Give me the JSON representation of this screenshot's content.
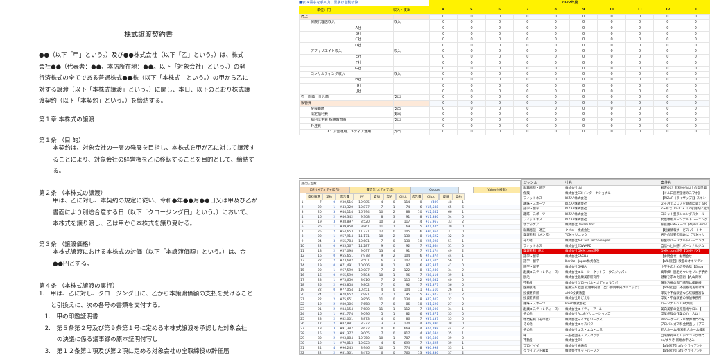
{
  "document": {
    "title": "株式譲渡契約書",
    "intro": [
      "●●（以下「甲」という。）及び●●株式会社（以下「乙」という。）は、株式",
      "会社●●（代表者：●●、本店所在地：●●。以下「対象会社」という。）の発",
      "行済株式の全てである普通株式●●株（以下「本株式」という。）の甲から乙に",
      "対する譲渡（以下「本株式譲渡」という。）に関し、本日、以下のとおり株式譲",
      "渡契約（以下「本契約」という。）を締結する。"
    ],
    "chapter1": "第１章 本株式の譲渡",
    "art1_title": "第１条 （目 的）",
    "art1": [
      "本契約は、対象会社の一層の発展を目指し、本株式を甲が乙に対して譲渡す",
      "ることにより、対象会社の経営権を乙に移転することを目的として、締結す",
      "る。"
    ],
    "art2_title": "第２条 （本株式の譲渡）",
    "art2": [
      "甲は、乙に対し、本契約の規定に従い、令和●年●●月●●日又は甲及び乙が",
      "書面により別途合意する日（以下「クロージング日」という。）において、",
      "本株式を譲り渡し、乙は甲から本株式を譲り受ける。"
    ],
    "art3_title": "第３条 （譲渡価格）",
    "art3": [
      "本株式譲渡における本株式の対価（以下「本譲渡価額」という。）は、金",
      "●●円とする。"
    ],
    "art4_title": "第４条 （本株式譲渡の実行）",
    "art4": [
      "1.　甲は、乙に対し、クロージング日に、乙から本譲渡価額の支払を受けること",
      "　　と引換えに、次の各号の書類を交付する。",
      "　1.　甲の印鑑証明書",
      "　2.　第５条第２号及び第９条第１号に定める本株式譲渡を承認した対象会社",
      "　　　の決議に係る議事録の原本証明付写し",
      "　3.　第１２条第１項及び第２項に定める対象会社の全取締役の辞任届"
    ]
  },
  "sheet": {
    "note": "■表 ※青字を手入力、黒字は自動計算",
    "unit_label": "単位：円",
    "col_kind": "収入・支出",
    "year_label": "2022年度",
    "months": [
      "4",
      "5",
      "6",
      "7",
      "8",
      "9",
      "10",
      "11",
      "12",
      "1"
    ],
    "rows": [
      {
        "label": "売上",
        "kind": "",
        "cls": "sec"
      },
      {
        "label": "保険代理店収入",
        "kind": "収入",
        "cls": "l1"
      },
      {
        "label": "A社",
        "kind": "",
        "cls": "l2"
      },
      {
        "label": "B社",
        "kind": "",
        "cls": "l2"
      },
      {
        "label": "C社",
        "kind": "",
        "cls": "l2"
      },
      {
        "label": "D社",
        "kind": "",
        "cls": "l2"
      },
      {
        "label": "アフィリエイト収入",
        "kind": "収入",
        "cls": "l1"
      },
      {
        "label": "E社",
        "kind": "",
        "cls": "l2"
      },
      {
        "label": "F社",
        "kind": "",
        "cls": "l2"
      },
      {
        "label": "G社",
        "kind": "",
        "cls": "l2"
      },
      {
        "label": "コンサルティング収入",
        "kind": "収入",
        "cls": "l1"
      },
      {
        "label": "H社",
        "kind": "",
        "cls": "l2"
      },
      {
        "label": "I社",
        "kind": "",
        "cls": "l2"
      },
      {
        "label": "J社",
        "kind": "",
        "cls": "l2"
      },
      {
        "label": "売上原価　仕入高",
        "kind": "支出",
        "cls": "l0"
      },
      {
        "label": "販管費",
        "kind": "",
        "cls": "sec"
      },
      {
        "label": "役員報酬",
        "kind": "支出",
        "cls": "l1"
      },
      {
        "label": "法定福利費",
        "kind": "支出",
        "cls": "l1"
      },
      {
        "label": "福利厚生費 採用教育費",
        "kind": "支出",
        "cls": "l1"
      },
      {
        "label": "外注費",
        "kind": "",
        "cls": "l1"
      },
      {
        "label": "X：広告運用、メディア運用",
        "kind": "支出",
        "cls": "l2"
      }
    ],
    "zero": "0"
  },
  "adsheet": {
    "title": "月次広告費",
    "groups": [
      "自社(メディア+広告)",
      "費広告(メディア枠)",
      "Google",
      "Yahoo!(検索)"
    ],
    "cols": [
      "資料請求",
      "契約",
      "広告費",
      "PV",
      "資請",
      "契約",
      "Click",
      "広告費",
      "Click",
      "資請",
      "契約"
    ],
    "rows": [
      [
        "1",
        "7",
        "0",
        "¥30,516",
        "10,985",
        "4",
        "0",
        "114",
        "0",
        "¥409",
        "48",
        "1"
      ],
      [
        "2",
        "29",
        "1",
        "¥43,320",
        "10,877",
        "7",
        "1",
        "74",
        "6",
        "¥15,588",
        "65",
        "6"
      ],
      [
        "3",
        "20",
        "3",
        "¥44,114",
        "16,794",
        "10",
        "2",
        "88",
        "10",
        "¥12,652",
        "66",
        "1"
      ],
      [
        "4",
        "16",
        "2",
        "¥46,342",
        "9,308",
        "8",
        "3",
        "91",
        "8",
        "¥11,380",
        "54",
        "0"
      ],
      [
        "5",
        "19",
        "3",
        "¥38,897",
        "8,520",
        "10",
        "3",
        "117",
        "4",
        "¥17,967",
        "33",
        "2"
      ],
      [
        "6",
        "26",
        "1",
        "¥39,850",
        "9,861",
        "11",
        "1",
        "69",
        "5",
        "¥21,445",
        "39",
        "0"
      ],
      [
        "7",
        "25",
        "2",
        "¥54,653",
        "11,731",
        "12",
        "0",
        "105",
        "6",
        "¥30,864",
        "37",
        "0"
      ],
      [
        "8",
        "20",
        "1",
        "¥57,914",
        "11,171",
        "10",
        "2",
        "130",
        "8",
        "¥16,622",
        "32",
        "0"
      ],
      [
        "9",
        "24",
        "3",
        "¥55,784",
        "10,601",
        "7",
        "0",
        "138",
        "10",
        "¥25,698",
        "51",
        "1"
      ],
      [
        "10",
        "22",
        "0",
        "¥55,567",
        "11,287",
        "9",
        "0",
        "92",
        "7",
        "¥22,864",
        "51",
        "0"
      ],
      [
        "11",
        "18",
        "2",
        "¥57,098",
        "9,097",
        "13",
        "4",
        "91",
        "7",
        "¥21,174",
        "49",
        "2"
      ],
      [
        "12",
        "16",
        "0",
        "¥55,651",
        "7,978",
        "9",
        "2",
        "104",
        "6",
        "¥27,874",
        "44",
        "1"
      ],
      [
        "13",
        "22",
        "2",
        "¥73,682",
        "8,501",
        "6",
        "3",
        "107",
        "7",
        "¥41,505",
        "56",
        "1"
      ],
      [
        "14",
        "19",
        "0",
        "¥71,491",
        "10,006",
        "8",
        "1",
        "97",
        "6",
        "¥42,341",
        "41",
        "0"
      ],
      [
        "15",
        "20",
        "1",
        "¥67,590",
        "10,087",
        "7",
        "2",
        "122",
        "8",
        "¥43,280",
        "34",
        "2"
      ],
      [
        "16",
        "16",
        "0",
        "¥65,590",
        "9,584",
        "10",
        "1",
        "96",
        "7",
        "¥38,116",
        "39",
        "1"
      ],
      [
        "17",
        "23",
        "1",
        "¥75,650",
        "8,616",
        "7",
        "2",
        "115",
        "12",
        "¥49,682",
        "40",
        "0"
      ],
      [
        "18",
        "25",
        "2",
        "¥65,858",
        "9,802",
        "7",
        "0",
        "92",
        "7",
        "¥51,377",
        "36",
        "0"
      ],
      [
        "19",
        "22",
        "0",
        "¥77,054",
        "10,451",
        "4",
        "0",
        "104",
        "11",
        "¥33,510",
        "26",
        "1"
      ],
      [
        "20",
        "24",
        "1",
        "¥78,652",
        "7,981",
        "2",
        "1",
        "95",
        "5",
        "¥53,977",
        "32",
        "2"
      ],
      [
        "21",
        "22",
        "2",
        "¥75,651",
        "9,856",
        "11",
        "0",
        "134",
        "8",
        "¥42,402",
        "32",
        "0"
      ],
      [
        "22",
        "19",
        "2",
        "¥80,306",
        "7,658",
        "7",
        "0",
        "86",
        "10",
        "¥41,520",
        "27",
        "2"
      ],
      [
        "23",
        "21",
        "2",
        "¥84,154",
        "7,680",
        "11",
        "1",
        "112",
        "7",
        "¥45,500",
        "34",
        "1"
      ],
      [
        "24",
        "16",
        "1",
        "¥81,774",
        "9,096",
        "5",
        "1",
        "82",
        "6",
        "¥37,871",
        "35",
        "0"
      ],
      [
        "25",
        "23",
        "2",
        "¥82,001",
        "8,873",
        "4",
        "0",
        "86",
        "7",
        "¥37,137",
        "35",
        "0"
      ],
      [
        "26",
        "17",
        "2",
        "¥87,881",
        "8,272",
        "3",
        "3",
        "124",
        "4",
        "¥29,880",
        "38",
        "0"
      ],
      [
        "27",
        "18",
        "3",
        "¥91,387",
        "8,672",
        "4",
        "6",
        "669",
        "4",
        "¥24,798",
        "44",
        "2"
      ],
      [
        "28",
        "15",
        "2",
        "¥91,377",
        "9,005",
        "7",
        "0",
        "917",
        "4",
        "¥30,684",
        "35",
        "1"
      ],
      [
        "29",
        "30",
        "2",
        "¥93,884",
        "10,750",
        "10",
        "1",
        "787",
        "9",
        "¥49,680",
        "39",
        "0"
      ],
      [
        "30",
        "19",
        "1",
        "¥79,813",
        "10,023",
        "4",
        "5",
        "699",
        "7",
        "¥44,825",
        "39",
        "1"
      ],
      [
        "31",
        "24",
        "4",
        "¥96,243",
        "8,946",
        "10",
        "1",
        "774",
        "8",
        "¥30,998",
        "33",
        "1"
      ],
      [
        "32",
        "22",
        "2",
        "¥81,301",
        "8,475",
        "6",
        "0",
        "760",
        "13",
        "¥46,330",
        "37",
        "2"
      ]
    ]
  },
  "list": {
    "col1": "ジャンル",
    "col2": "社名",
    "col3": "案件名",
    "rows": [
      [
        "就職相談・適正",
        "株式会社dsi",
        "顧客OK！有料90%以上の高単価"
      ],
      [
        "保険",
        "株式会社CBJインターナショナル",
        "【ドル口座希望者のスマホ】"
      ],
      [
        "フィットネス",
        "RIZAP株式会社",
        "【RIZAP（ライザップ）】スキン"
      ],
      [
        "趣味・スポーツ",
        "RIZAP株式会社",
        "２ヶ月でスコアを劇的に変えるR"
      ],
      [
        "語学・留学",
        "RIZAP株式会社",
        "2ヶ月でTOEICスコアを劇的に変え"
      ],
      [
        "趣味・スポーツ",
        "RIZAP株式会社",
        "コミット型ランニングスクール"
      ],
      [
        "フィットネス",
        "RIZAP株式会社",
        "女性専用パーソナルトレーニング"
      ],
      [
        "ボディケア",
        "株式会社Dream box",
        "家庭用EMSスーツ【Alpha Armo"
      ],
      [
        "就職相談・適正",
        "クメニ・株式会社",
        "【起業情報サービス パートナー"
      ],
      [
        "美容外科（メンズ）",
        "TCMクリニック",
        "男性の顔髪の悩みに【TCMクリ"
      ],
      [
        "その他",
        "株式会社ABCash Technologies",
        "お金のパーソナルトレーニング"
      ],
      [
        "フィットネス",
        "株式会社EDWARD",
        "自信へと体感！パーソナルジム"
      ],
      [
        "美容外科（RK）",
        "株式会社DMM.com証券",
        "DMM.com証券【DMM FX】"
      ],
      [
        "語学・留学",
        "株式会社SASHA",
        "【お問合せ】お問合せ"
      ],
      [
        "語学・留学",
        "Berlitz・Japan株式会社",
        "【afb限定】教室のオキリテン"
      ],
      [
        "語学・留学",
        "株式会社GABA",
        "小学生のための英会話【Gaba"
      ],
      [
        "起業エステ（レディース）",
        "株式会社エル・シーネットワークスジャパン",
        "高単価！脱毛カウンセリング予約"
      ],
      [
        "脱毛",
        "株式会社健康美容研究所",
        "健康を求めた施術【九山商事】"
      ],
      [
        "不動産",
        "株式会社グローバル・メディカルラボ",
        "薄毛治療の専門病院は都銀様"
      ],
      [
        "医療脱毛",
        "医療法人社団 就寝中央会（出：御岡中央クリニック）",
        "【afb限定】【不完脱毛お助けキ"
      ],
      [
        "投資教育所",
        "AKIO投資教室",
        "浮気や不倫調査なら経験豊富な"
      ],
      [
        "投資教育所",
        "株式会社あどえる",
        "浮気・不倫調査の探偵事務所"
      ],
      [
        "趣味・スポーツ",
        "Fresh株式会社",
        "パーソナルジムFit大阪"
      ],
      [
        "起業エステ（レディース）",
        "株式会社エイティーアール",
        "美白美肌の全身施術サロン【"
      ],
      [
        "その他",
        "株式会社ALL&ソリューションズ",
        "浮気相談の作業の力　人以上！"
      ],
      [
        "専門転職（その他）",
        "株式会社マイナビワークス",
        "Web・ゲーム・IT業界専門の転"
      ],
      [
        "その他",
        "株式会社エキスパタ",
        "プロバンガス料金見直し【プロ"
      ],
      [
        "その他",
        "株式会社エス・エム・エス",
        "老人ホーム/有料老人ホーム検索"
      ],
      [
        "車",
        "一般社団法人アスクラボ",
        "自宅保有車のレジェンドが専門"
      ],
      [
        "不動産",
        "株式会社ZIS",
        "ec/ゆりき 新規お申込み"
      ],
      [
        "プロバイダ",
        "株式会社光通信",
        "【afb限定】afb クライアント"
      ],
      [
        "クライアント募集",
        "株式会社ネットパーソン",
        "【afb限定】afb クライアント"
      ]
    ]
  }
}
